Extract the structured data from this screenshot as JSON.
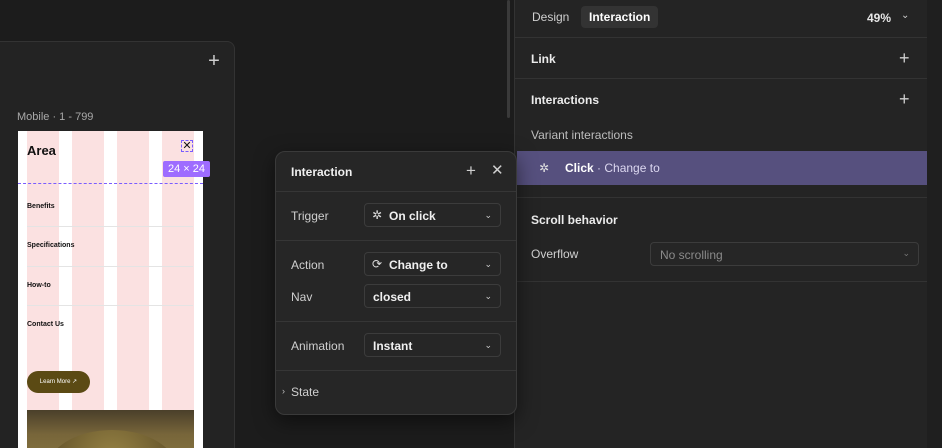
{
  "canvas": {
    "frame_label": "Mobile · 1 - 799",
    "mobile": {
      "logo": "Area",
      "nav_items": [
        "Benefits",
        "Specifications",
        "How-to",
        "Contact Us"
      ],
      "button_label": "Learn More ↗",
      "close_glyph": "✕"
    },
    "size_badge": "24 × 24"
  },
  "panel": {
    "tabs": [
      {
        "label": "Design",
        "active": false
      },
      {
        "label": "Interaction",
        "active": true
      }
    ],
    "zoom": "49%",
    "sections": {
      "link": "Link",
      "interactions": "Interactions",
      "variant_interactions": "Variant interactions",
      "selected_interaction": {
        "trigger": "Click",
        "action": "· Change to"
      },
      "scroll_behavior": "Scroll behavior",
      "overflow_label": "Overflow",
      "overflow_value": "No scrolling"
    }
  },
  "popover": {
    "title": "Interaction",
    "fields": {
      "trigger_label": "Trigger",
      "trigger_value": "On click",
      "action_label": "Action",
      "action_value": "Change to",
      "nav_label": "Nav",
      "nav_value": "closed",
      "animation_label": "Animation",
      "animation_value": "Instant"
    },
    "state_label": "State"
  }
}
